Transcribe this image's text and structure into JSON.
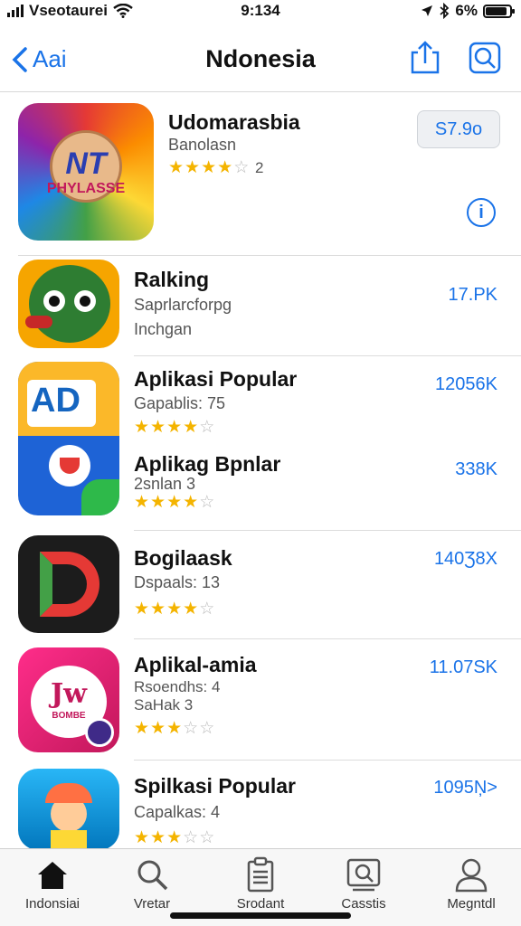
{
  "status_bar": {
    "carrier": "Vseotaurei",
    "time": "9:134",
    "battery": "6%",
    "battery_level": 0.9
  },
  "nav": {
    "back_label": "Aai",
    "title": "Ndonesia"
  },
  "apps": [
    {
      "name": "Udomarasbia",
      "subtitle": "Banolasn",
      "rating_text": "2",
      "stars": 3.5,
      "price": "S7.9o",
      "icon": "app-icon-nt-phylasse"
    },
    {
      "name": "Ralking",
      "subtitle": "Saprlarcforpg",
      "subtitle2": "Inchgan",
      "price": "17.PK",
      "icon": "app-icon-green-creature"
    },
    {
      "name": "Aplikasi Popular",
      "subtitle": "Gapablis: 75",
      "stars": 3.5,
      "price": "12056K",
      "icon": "app-icon-ad"
    },
    {
      "name": "Aplikag Bpnlar",
      "subtitle": "2snlan 3",
      "stars": 3.5,
      "price": "338K"
    },
    {
      "name": "Bogilaask",
      "subtitle": "Dspaals: 13",
      "stars": 4,
      "price": "140Ʒ8X",
      "icon": "app-icon-d-logo"
    },
    {
      "name": "Aplikal-amia",
      "subtitle": "Rsoendhs: 4",
      "subtitle2": "SaHak 3",
      "stars": 3,
      "price": "11.07SK",
      "icon": "app-icon-jw"
    },
    {
      "name": "Spilkasi Popular",
      "subtitle": "Capalkas: 4",
      "stars": 3,
      "price": "1095Ņ>",
      "icon": "app-icon-cartoon"
    }
  ],
  "icon_texts": {
    "nt": "NT",
    "phylasse": "PHYLASSE",
    "ad": "AD",
    "jw": "Jw",
    "jw_sub": "BOMBE"
  },
  "tabs": [
    {
      "label": "Indonsiai",
      "icon": "home-icon"
    },
    {
      "label": "Vretar",
      "icon": "search-icon"
    },
    {
      "label": "Srodant",
      "icon": "clipboard-icon"
    },
    {
      "label": "Casstis",
      "icon": "search-screen-icon"
    },
    {
      "label": "Megntdl",
      "icon": "person-icon"
    }
  ],
  "colors": {
    "accent": "#1a73e8",
    "star": "#f4b400"
  }
}
